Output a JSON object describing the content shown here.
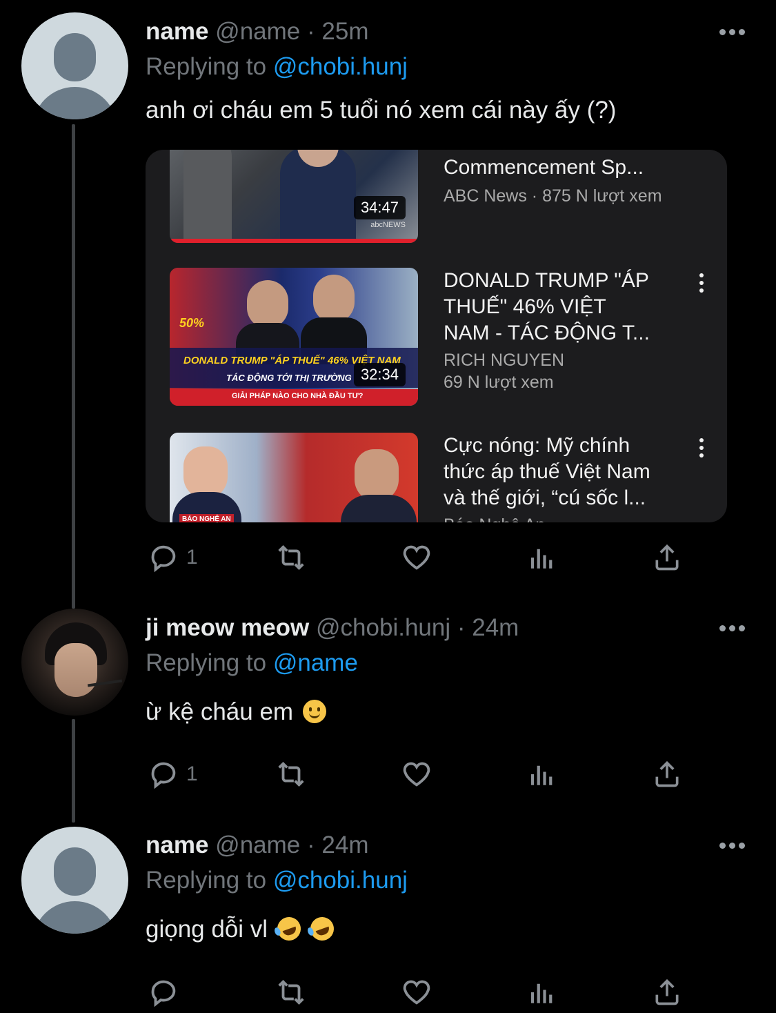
{
  "tweets": [
    {
      "display_name": "name",
      "handle": "@name",
      "time": "25m",
      "replying_label": "Replying to",
      "replying_to": "@chobi.hunj",
      "text": "anh ơi cháu em 5 tuổi nó xem cái này ấy (?)",
      "reply_count": "1"
    },
    {
      "display_name": "ji meow meow",
      "handle": "@chobi.hunj",
      "time": "24m",
      "replying_label": "Replying to",
      "replying_to": "@name",
      "text": "ừ kệ cháu em",
      "reply_count": "1"
    },
    {
      "display_name": "name",
      "handle": "@name",
      "time": "24m",
      "replying_label": "Replying to",
      "replying_to": "@chobi.hunj",
      "text": "giọng dỗi vl",
      "reply_count": ""
    }
  ],
  "separator": "·",
  "embed": {
    "videos": [
      {
        "title": "Commencement Sp...",
        "channel_views": "ABC News · 875 N lượt xem",
        "duration": "34:47",
        "thumb_text": "abcNEWS"
      },
      {
        "title": "DONALD TRUMP \"ÁP\nTHUẾ\" 46% VIỆT\nNAM  - TÁC ĐỘNG T...",
        "channel": "RICH NGUYEN",
        "views": "69 N lượt xem",
        "duration": "32:34",
        "thumb_text_1": "DONALD TRUMP \"ÁP THUẾ\" 46% VIỆT NAM",
        "thumb_text_2": "TÁC ĐỘNG TỚI THỊ TRƯỜNG",
        "thumb_text_3": "GIẢI PHÁP NÀO CHO NHÀ ĐẦU TƯ?",
        "thumb_badge": "50%"
      },
      {
        "title": "Cực nóng: Mỹ chính\nthức áp thuế Việt Nam\nvà thế giới, “cú sốc l...",
        "channel": "Báo Nghệ An",
        "thumb_text": "BÁO NGHỆ AN"
      }
    ]
  },
  "icons": {
    "reply": "reply-icon",
    "retweet": "retweet-icon",
    "like": "like-icon",
    "views": "views-icon",
    "share": "share-icon",
    "more": "more-icon"
  },
  "colors": {
    "background": "#000000",
    "link": "#1d9bf0",
    "muted": "#71767b",
    "card": "#1c1c1e",
    "progress": "#e0202c"
  }
}
